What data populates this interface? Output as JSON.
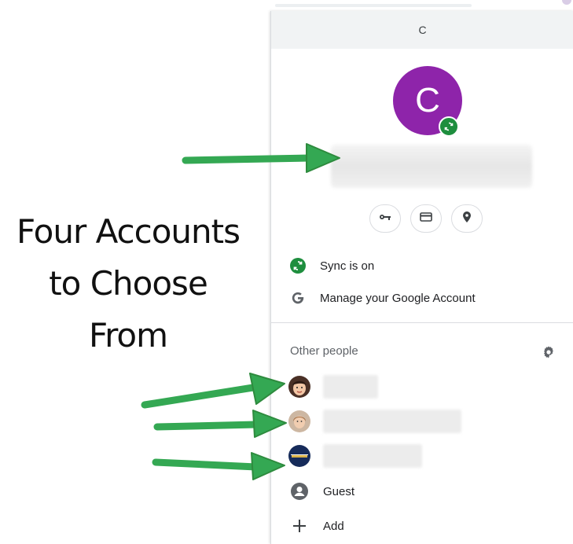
{
  "annotation": {
    "lines": [
      "Four Accounts",
      "to Choose",
      "From"
    ]
  },
  "panel": {
    "header_title": "C",
    "avatar_letter": "C",
    "quick_icons": [
      "key-icon",
      "credit-card-icon",
      "location-pin-icon"
    ],
    "sync_label": "Sync is on",
    "manage_label": "Manage your Google Account",
    "other_people_title": "Other people",
    "guest_label": "Guest",
    "add_label": "Add"
  },
  "colors": {
    "avatar": "#8e24aa",
    "sync_green": "#1e8e3e",
    "arrow_green": "#34a853",
    "header_bg": "#f1f3f4"
  }
}
